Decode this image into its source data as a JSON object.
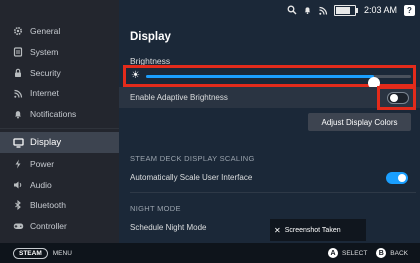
{
  "status_bar": {
    "time": "2:03 AM",
    "help": "?",
    "battery_level": 0.8
  },
  "sidebar": {
    "items": [
      {
        "label": "General",
        "icon": "gear-icon"
      },
      {
        "label": "System",
        "icon": "system-icon"
      },
      {
        "label": "Security",
        "icon": "lock-icon"
      },
      {
        "label": "Internet",
        "icon": "wifi-icon"
      },
      {
        "label": "Notifications",
        "icon": "bell-icon"
      },
      {
        "label": "Display",
        "icon": "monitor-icon",
        "active": true
      },
      {
        "label": "Power",
        "icon": "lightning-icon"
      },
      {
        "label": "Audio",
        "icon": "speaker-icon"
      },
      {
        "label": "Bluetooth",
        "icon": "bluetooth-icon"
      },
      {
        "label": "Controller",
        "icon": "gamepad-icon"
      }
    ]
  },
  "main": {
    "title": "Display",
    "brightness_label": "Brightness",
    "brightness_level": 0.86,
    "adaptive_label": "Enable Adaptive Brightness",
    "adaptive_enabled": false,
    "adjust_colors_button": "Adjust Display Colors",
    "scaling_section": "STEAM DECK DISPLAY SCALING",
    "auto_scale_label": "Automatically Scale User Interface",
    "auto_scale_enabled": true,
    "night_section": "NIGHT MODE",
    "schedule_label": "Schedule Night Mode"
  },
  "toast": {
    "text": "Screenshot Taken"
  },
  "bottom_bar": {
    "steam": "STEAM",
    "menu": "MENU",
    "a_button": "A",
    "select": "SELECT",
    "b_button": "B",
    "back": "BACK"
  },
  "colors": {
    "accent": "#1a9fff",
    "highlight_box": "#e32b1b",
    "background": "#1b2838",
    "sidebar": "#23262e"
  }
}
